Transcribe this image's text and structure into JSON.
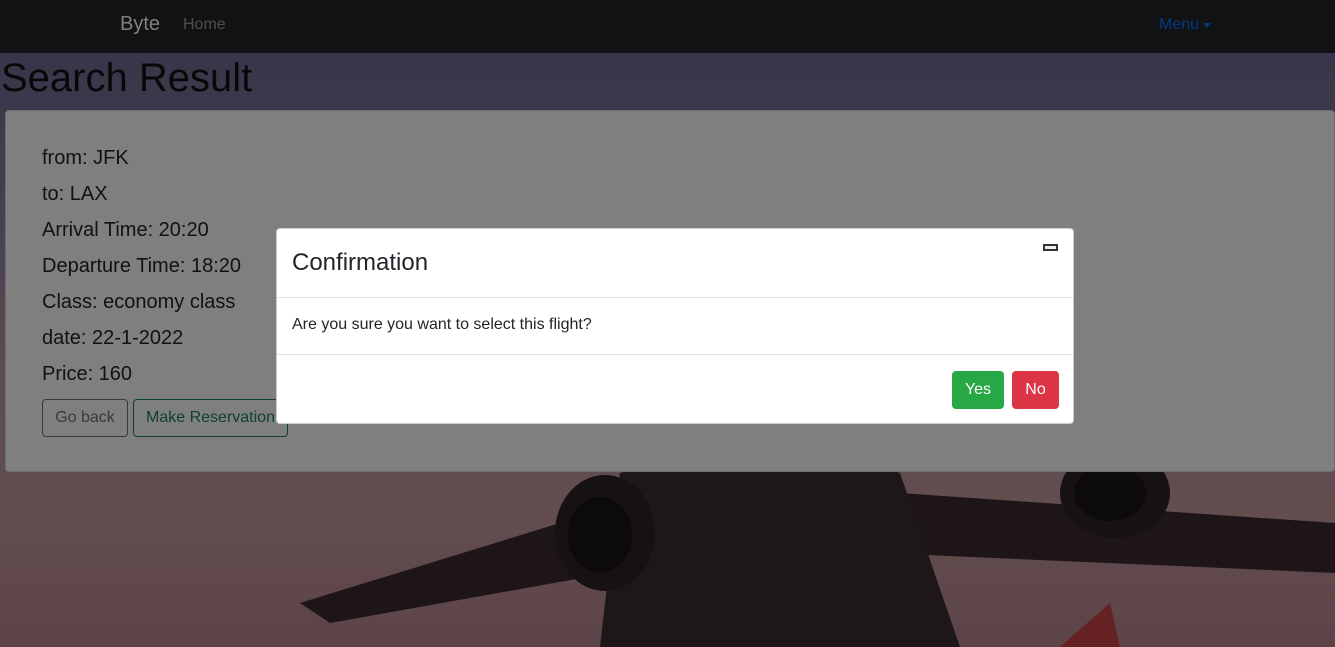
{
  "navbar": {
    "brand": "Byte",
    "home": "Home",
    "menu": "Menu"
  },
  "page": {
    "title": "Search Result"
  },
  "flight": {
    "from": "from: JFK",
    "to": "to: LAX",
    "arrival": "Arrival Time: 20:20",
    "departure": "Departure Time: 18:20",
    "class": "Class: economy class",
    "date": "date: 22-1-2022",
    "price": "Price: 160"
  },
  "actions": {
    "go_back": "Go back",
    "make_reservation": "Make Reservation"
  },
  "modal": {
    "title": "Confirmation",
    "message": "Are you sure you want to select this flight?",
    "yes": "Yes",
    "no": "No"
  },
  "colors": {
    "navbar": "#212529",
    "menu_link": "#0d6efd",
    "yes_button": "#28a745",
    "no_button": "#dc3545",
    "reservation_outline": "#198754"
  }
}
